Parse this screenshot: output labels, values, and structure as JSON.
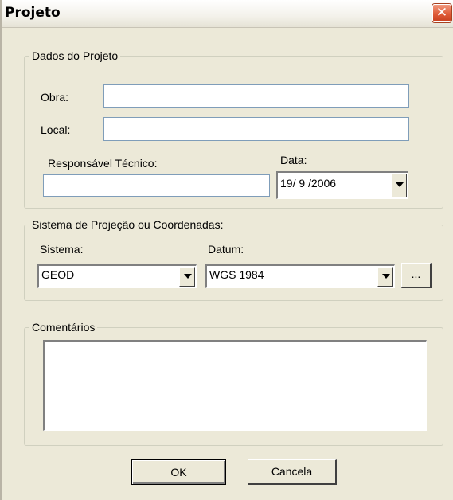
{
  "window": {
    "title": "Projeto",
    "close_glyph": "✕"
  },
  "dados": {
    "legend": "Dados do Projeto",
    "obra_label": "Obra:",
    "obra_value": "",
    "local_label": "Local:",
    "local_value": "",
    "responsavel_label": "Responsável Técnico:",
    "responsavel_value": "",
    "data_label": "Data:",
    "data_value": "19/ 9 /2006"
  },
  "sistema": {
    "legend": "Sistema de Projeção ou Coordenadas:",
    "sistema_label": "Sistema:",
    "sistema_value": "GEOD",
    "datum_label": "Datum:",
    "datum_value": "WGS 1984",
    "browse_label": "..."
  },
  "comentarios": {
    "legend": "Comentários",
    "value": ""
  },
  "buttons": {
    "ok_label": "OK",
    "cancel_label": "Cancela"
  },
  "icons": {
    "dropdown": "chevron-down-icon",
    "close": "close-icon"
  }
}
